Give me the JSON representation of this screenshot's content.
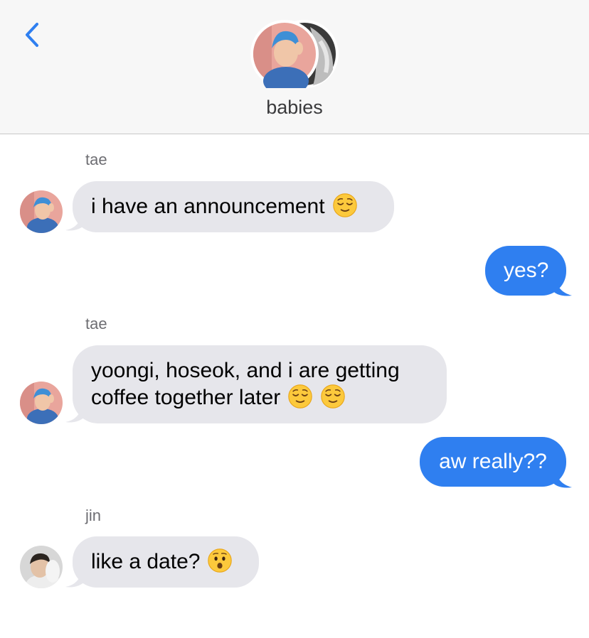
{
  "header": {
    "group_name": "babies",
    "back_icon": "chevron-left-icon"
  },
  "colors": {
    "accent": "#2f7ff0",
    "received_bubble": "#e6e6eb",
    "header_bg": "#f7f7f7"
  },
  "messages": [
    {
      "sender": "tae",
      "text": "i have an announcement",
      "emoji": "relieved-face-emoji"
    },
    {
      "text": "yes?"
    },
    {
      "sender": "tae",
      "line1": "yoongi, hoseok, and i are getting",
      "line2": "coffee together later",
      "emoji": "relieved-face-emoji"
    },
    {
      "text": "aw really??"
    },
    {
      "sender": "jin",
      "text": "like a date?",
      "emoji": "hushed-face-emoji"
    }
  ]
}
